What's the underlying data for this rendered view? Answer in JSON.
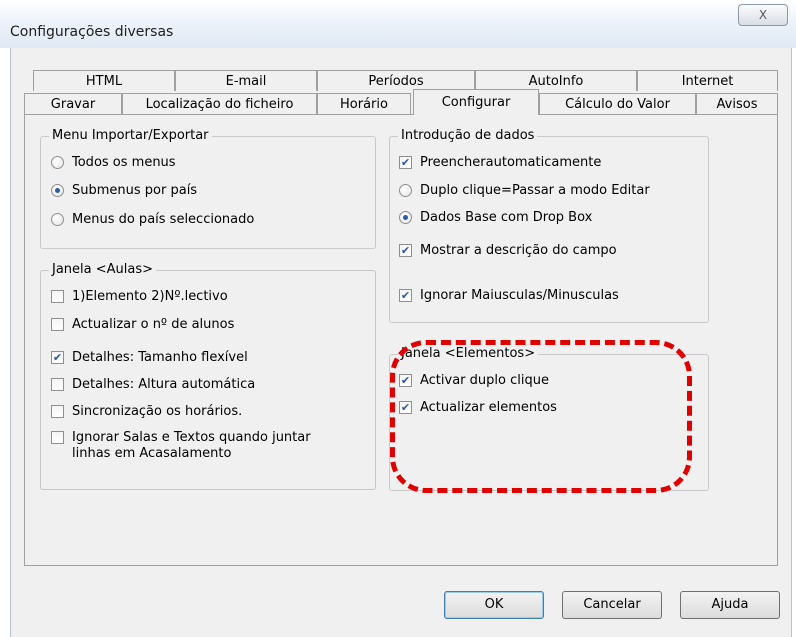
{
  "window": {
    "title": "Configurações diversas",
    "close_label": "X"
  },
  "tabs_row1": [
    "HTML",
    "E-mail",
    "Períodos",
    "AutoInfo",
    "Internet"
  ],
  "tabs_row2": [
    "Gravar",
    "Localização do ficheiro",
    "Horário",
    "Configurar",
    "Cálculo do Valor",
    "Avisos"
  ],
  "active_tab": "Configurar",
  "menu_group": {
    "title": "Menu Importar/Exportar",
    "options": [
      {
        "label": "Todos os menus",
        "selected": false
      },
      {
        "label": "Submenus por país",
        "selected": true
      },
      {
        "label": "Menus do país seleccionado",
        "selected": false
      }
    ]
  },
  "aulas_group": {
    "title": "Janela <Aulas>",
    "options": [
      {
        "label": "1)Elemento 2)Nº.lectivo",
        "checked": false
      },
      {
        "label": "Actualizar o nº de alunos",
        "checked": false
      },
      {
        "label": "Detalhes: Tamanho flexível",
        "checked": true
      },
      {
        "label": "Detalhes: Altura automática",
        "checked": false
      },
      {
        "label": "Sincronização os horários.",
        "checked": false
      },
      {
        "label": "Ignorar Salas e Textos quando juntar",
        "label2": "linhas em Acasalamento",
        "checked": false
      }
    ]
  },
  "dados_group": {
    "title": "Introdução de dados",
    "preencher": {
      "label": "Preencherautomaticamente",
      "checked": true
    },
    "duplo_clique": {
      "label": "Duplo clique=Passar a modo Editar",
      "selected": false
    },
    "dados_base": {
      "label": "Dados Base com Drop Box",
      "selected": true
    },
    "mostrar": {
      "label": "Mostrar a descrição do campo",
      "checked": true
    },
    "ignorar": {
      "label": "Ignorar Maiusculas/Minusculas",
      "checked": true
    }
  },
  "elementos_group": {
    "title": "Janela <Elementos>",
    "activar": {
      "label": "Activar duplo clique",
      "checked": true
    },
    "actualizar": {
      "label": "Actualizar elementos",
      "checked": true
    }
  },
  "buttons": {
    "ok": "OK",
    "cancel": "Cancelar",
    "help": "Ajuda"
  },
  "colors": {
    "highlight": "#e00000",
    "check": "#2b54a8"
  },
  "check_glyph": "✔"
}
